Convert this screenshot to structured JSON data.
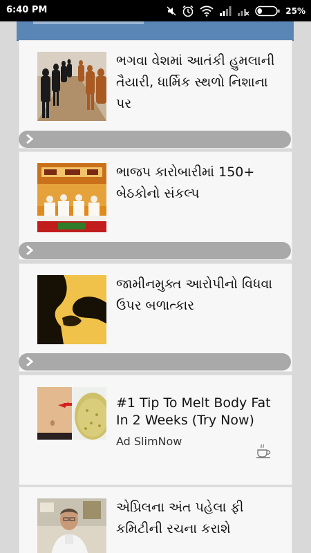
{
  "status_bar": {
    "time": "6:40 PM",
    "battery_percent": "25%",
    "battery_level": 0.25,
    "icons": [
      "mute-icon",
      "alarm-icon",
      "wifi-icon",
      "signal-icon",
      "signal-no-sim-icon",
      "battery-icon"
    ]
  },
  "feed": {
    "items": [
      {
        "title": "ભગવા વેશમાં આતંકી હુમલાની તૈયારી, ધાર્મિક સ્થળો નિશાના પર"
      },
      {
        "title": "ભાજપ કારોબારીમાં 150+ બેઠકોનો સંકલ્પ"
      },
      {
        "title": "જામીનમુક્ત આરોપીનો વિધવા ઉપર બળાત્કાર"
      },
      {
        "title": "એપ્રિલના અંત પહેલા ફી કમિટીની રચના કરાશે"
      }
    ],
    "ad": {
      "title": "#1 Tip To Melt Body Fat In 2 Weeks (Try Now)",
      "source": "Ad SlimNow"
    }
  },
  "colors": {
    "status_bar": "#000000",
    "banner": "#5a86b5",
    "card": "#f7f7f7",
    "divider": "#a9a9a9",
    "background": "#d9d9d9"
  }
}
